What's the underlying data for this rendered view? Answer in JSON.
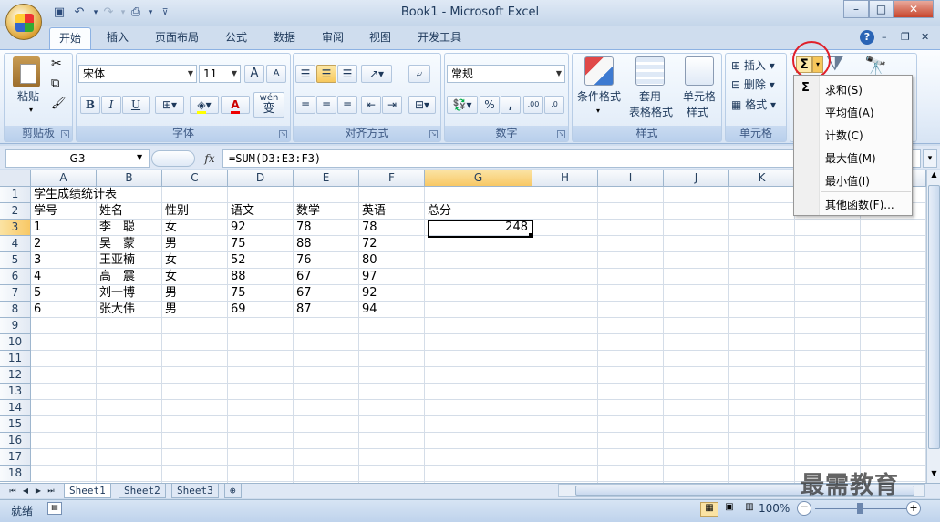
{
  "window": {
    "title": "Book1 - Microsoft Excel",
    "min": "–",
    "max": "□",
    "close": "✕"
  },
  "ribbon_tabs": [
    "开始",
    "插入",
    "页面布局",
    "公式",
    "数据",
    "审阅",
    "视图",
    "开发工具"
  ],
  "clipboard": {
    "paste": "粘贴",
    "group": "剪贴板"
  },
  "font": {
    "name": "宋体",
    "size": "11",
    "group": "字体",
    "bold": "B",
    "italic": "I",
    "underline": "U",
    "grow": "A",
    "shrink": "A",
    "color_letter": "A",
    "wen": "wén",
    "wen_char": "变"
  },
  "alignment": {
    "group": "对齐方式"
  },
  "number": {
    "format": "常规",
    "group": "数字",
    "percent": "%",
    "comma": ",",
    "inc": ".00",
    "dec": ".0"
  },
  "styles": {
    "conditional": "条件格式",
    "table_line1": "套用",
    "table_line2": "表格格式",
    "cell_line1": "单元格",
    "cell_line2": "样式",
    "group": "样式"
  },
  "cells": {
    "insert": "插入",
    "delete": "删除",
    "format": "格式",
    "group": "单元格"
  },
  "editing": {
    "sigma": "Σ"
  },
  "formula_bar": {
    "name_box": "G3",
    "fx": "fx",
    "formula": "=SUM(D3:E3:F3)"
  },
  "columns": [
    "A",
    "B",
    "C",
    "D",
    "E",
    "F",
    "G",
    "H",
    "I",
    "J",
    "K"
  ],
  "rows": [
    "1",
    "2",
    "3",
    "4",
    "5",
    "6",
    "7",
    "8",
    "9",
    "10",
    "11",
    "12",
    "13",
    "14",
    "15",
    "16",
    "17",
    "18"
  ],
  "sheet": {
    "title": "学生成绩统计表",
    "headers": [
      "学号",
      "姓名",
      "性别",
      "语文",
      "数学",
      "英语",
      "总分"
    ],
    "records": [
      [
        "1",
        "李　聪",
        "女",
        "92",
        "78",
        "78"
      ],
      [
        "2",
        "吴　蒙",
        "男",
        "75",
        "88",
        "72"
      ],
      [
        "3",
        "王亚楠",
        "女",
        "52",
        "76",
        "80"
      ],
      [
        "4",
        "高　震",
        "女",
        "88",
        "67",
        "97"
      ],
      [
        "5",
        "刘一博",
        "男",
        "75",
        "67",
        "92"
      ],
      [
        "6",
        "张大伟",
        "男",
        "69",
        "87",
        "94"
      ]
    ],
    "g3_value": "248"
  },
  "sheet_tabs": [
    "Sheet1",
    "Sheet2",
    "Sheet3"
  ],
  "status": {
    "ready": "就绪",
    "zoom": "100%",
    "minus": "－",
    "plus": "+"
  },
  "autosum_menu": [
    "求和(S)",
    "平均值(A)",
    "计数(C)",
    "最大值(M)",
    "最小值(I)",
    "其他函数(F)..."
  ],
  "watermark": "最需教育"
}
